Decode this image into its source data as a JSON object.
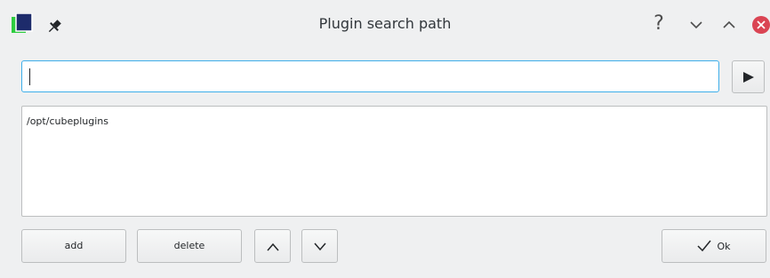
{
  "window": {
    "title": "Plugin search path",
    "help_label": "?"
  },
  "path_input": {
    "value": ""
  },
  "path_list": {
    "items": [
      "/opt/cubeplugins"
    ]
  },
  "buttons": {
    "add": "add",
    "delete": "delete",
    "ok": "Ok"
  },
  "icons": {
    "app": "app-icon",
    "pin": "pin-icon",
    "help": "help-icon",
    "minimize": "chevron-down-icon",
    "maximize": "chevron-up-icon",
    "close": "close-icon",
    "run": "play-icon",
    "move_up": "chevron-up-icon",
    "move_down": "chevron-down-icon",
    "ok": "checkmark-icon"
  },
  "colors": {
    "accent": "#3daee9",
    "close": "#da4453",
    "background": "#eff0f1"
  }
}
